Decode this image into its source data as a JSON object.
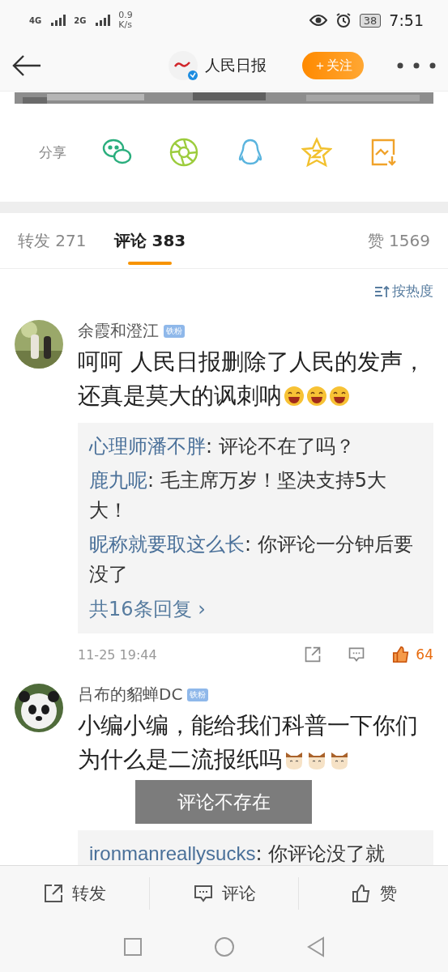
{
  "status_bar": {
    "network_1": "4G",
    "network_2": "2G",
    "speed": "0.9",
    "speed_unit": "K/s",
    "battery": "38",
    "time": "7:51"
  },
  "header": {
    "title": "人民日报",
    "follow_button": "＋关注"
  },
  "share": {
    "label": "分享",
    "targets": [
      {
        "kind": "wechat"
      },
      {
        "kind": "moments"
      },
      {
        "kind": "qq"
      },
      {
        "kind": "qzone"
      },
      {
        "kind": "save"
      }
    ]
  },
  "tabs": [
    {
      "label": "转发 271",
      "selected": false
    },
    {
      "label": "评论 383",
      "selected": true
    },
    {
      "label": "赞 1569",
      "selected": false
    }
  ],
  "sort": "按热度",
  "comments": [
    {
      "name": "余霞和澄江",
      "badge": "铁粉",
      "text": "呵呵 人民日报删除了人民的发声，还真是莫大的讽刺呐",
      "emojis": [
        {
          "kind": "laugh"
        },
        {
          "kind": "laugh"
        },
        {
          "kind": "laugh"
        }
      ],
      "replies": [
        {
          "author": "心理师潘不胖",
          "text": ": 评论不在了吗？"
        },
        {
          "author": "鹿九呢",
          "text": ": 毛主席万岁！坚决支持5大大！"
        },
        {
          "author": "昵称就要取这么长",
          "text": ": 你评论一分钟后要没了"
        }
      ],
      "more_replies": "共16条回复",
      "more_replies_arrow": "›",
      "time": "11-25 19:44",
      "likes": "64",
      "liked": true
    },
    {
      "name": "吕布的貂蝉DC",
      "badge": "铁粉",
      "text": "小编小编，能给我们科普一下你们为什么是二流报纸吗",
      "emojis": [
        {
          "kind": "cat"
        },
        {
          "kind": "cat"
        },
        {
          "kind": "cat"
        }
      ],
      "replies": [
        {
          "author": "ironmanreallysucks",
          "text": ": 你评论没了就"
        }
      ]
    }
  ],
  "toast": "评论不存在",
  "bottom_bar": [
    {
      "kind": "repost",
      "label": "转发"
    },
    {
      "kind": "comment",
      "label": "评论"
    },
    {
      "kind": "like",
      "label": "赞"
    }
  ]
}
